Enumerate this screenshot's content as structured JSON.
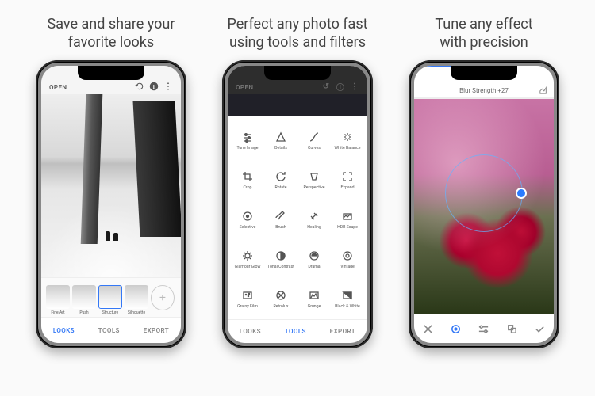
{
  "captions": {
    "c1a": "Save and share your",
    "c1b": "favorite looks",
    "c2a": "Perfect any photo fast",
    "c2b": "using tools and filters",
    "c3a": "Tune any effect",
    "c3b": "with precision"
  },
  "topbar": {
    "open": "OPEN"
  },
  "filters": [
    "Fine Art",
    "Push",
    "Structure",
    "Silhouette"
  ],
  "tabs": {
    "looks": "LOOKS",
    "tools": "TOOLS",
    "export": "EXPORT"
  },
  "tools": [
    {
      "id": "tune-image",
      "label": "Tune Image"
    },
    {
      "id": "details",
      "label": "Details"
    },
    {
      "id": "curves",
      "label": "Curves"
    },
    {
      "id": "white-balance",
      "label": "White Balance"
    },
    {
      "id": "crop",
      "label": "Crop"
    },
    {
      "id": "rotate",
      "label": "Rotate"
    },
    {
      "id": "perspective",
      "label": "Perspective"
    },
    {
      "id": "expand",
      "label": "Expand"
    },
    {
      "id": "selective",
      "label": "Selective"
    },
    {
      "id": "brush",
      "label": "Brush"
    },
    {
      "id": "healing",
      "label": "Healing"
    },
    {
      "id": "hdr-scape",
      "label": "HDR Scape"
    },
    {
      "id": "glamour-glow",
      "label": "Glamour Glow"
    },
    {
      "id": "tonal-contrast",
      "label": "Tonal Contrast"
    },
    {
      "id": "drama",
      "label": "Drama"
    },
    {
      "id": "vintage",
      "label": "Vintage"
    },
    {
      "id": "grainy-film",
      "label": "Grainy Film"
    },
    {
      "id": "retrolux",
      "label": "Retrolux"
    },
    {
      "id": "grunge",
      "label": "Grunge"
    },
    {
      "id": "black-white",
      "label": "Black & White"
    }
  ],
  "slider": {
    "label": "Blur Strength +27"
  }
}
